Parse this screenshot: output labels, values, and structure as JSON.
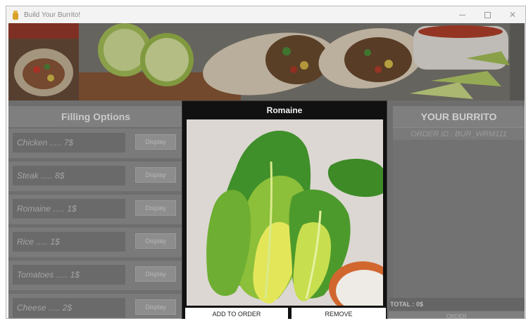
{
  "window": {
    "title": "Build Your Burrito!",
    "controls": {
      "minimize": "minimize",
      "maximize": "maximize",
      "close": "✕"
    }
  },
  "filling": {
    "header": "Filling Options",
    "items": [
      {
        "label": "Chicken ..... 7$",
        "button": "Display"
      },
      {
        "label": "Steak ..... 8$",
        "button": "Display"
      },
      {
        "label": "Romaine ..... 1$",
        "button": "Display"
      },
      {
        "label": "Rice ..... 1$",
        "button": "Display"
      },
      {
        "label": "Tomatoes ..... 1$",
        "button": "Display"
      },
      {
        "label": "Cheese ..... 2$",
        "button": "Display"
      }
    ]
  },
  "burrito": {
    "header": "YOUR BURRITO",
    "order_id": "ORDER ID : BUR_WRM111",
    "total": "TOTAL : 0$",
    "order_button": "ORDER"
  },
  "popup": {
    "title": "Romaine",
    "add_button": "ADD TO ORDER",
    "remove_button": "REMOVE"
  }
}
